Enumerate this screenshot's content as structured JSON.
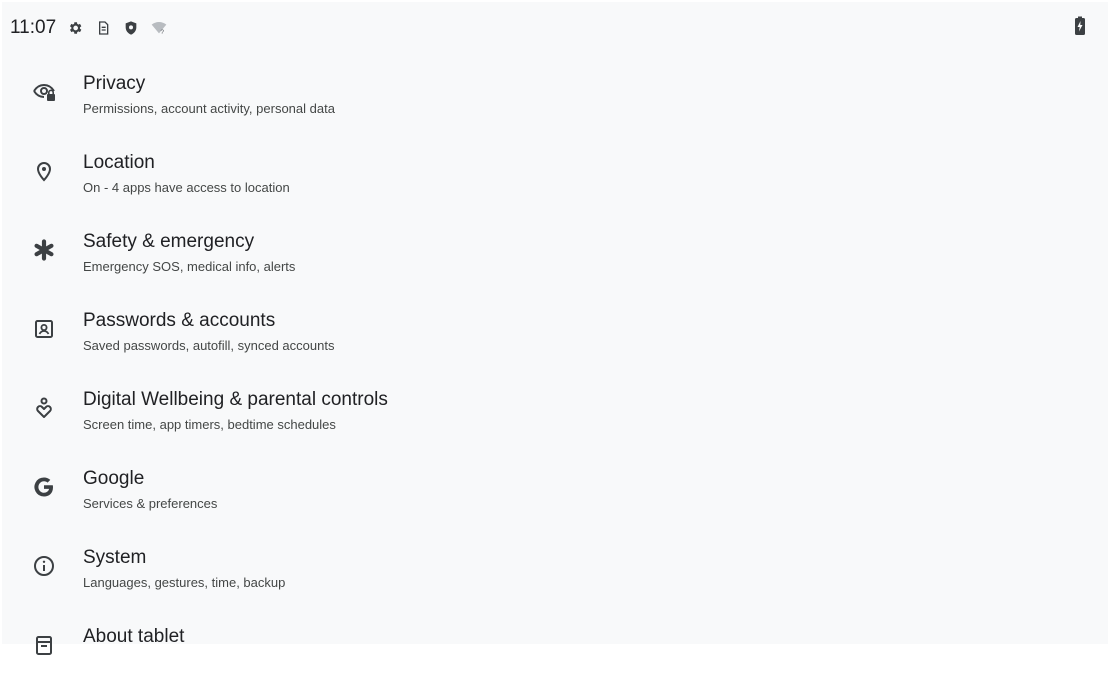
{
  "status_bar": {
    "time": "11:07",
    "icons": [
      "gear-icon",
      "sim-icon",
      "shield-icon",
      "wifi-question-icon"
    ],
    "battery_icon": "battery-charging-icon"
  },
  "settings": {
    "items": [
      {
        "icon": "privacy-icon",
        "title": "Privacy",
        "subtitle": "Permissions, account activity, personal data"
      },
      {
        "icon": "location-pin-icon",
        "title": "Location",
        "subtitle": "On - 4 apps have access to location"
      },
      {
        "icon": "asterisk-icon",
        "title": "Safety & emergency",
        "subtitle": "Emergency SOS, medical info, alerts"
      },
      {
        "icon": "account-box-icon",
        "title": "Passwords & accounts",
        "subtitle": "Saved passwords, autofill, synced accounts"
      },
      {
        "icon": "wellbeing-icon",
        "title": "Digital Wellbeing & parental controls",
        "subtitle": "Screen time, app timers, bedtime schedules"
      },
      {
        "icon": "google-g-icon",
        "title": "Google",
        "subtitle": "Services & preferences"
      },
      {
        "icon": "info-icon",
        "title": "System",
        "subtitle": "Languages, gestures, time, backup"
      },
      {
        "icon": "tablet-icon",
        "title": "About tablet",
        "subtitle": ""
      }
    ]
  }
}
